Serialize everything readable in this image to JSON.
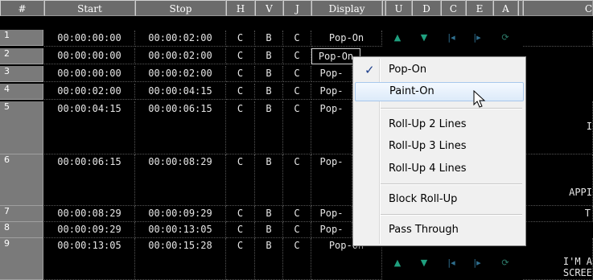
{
  "columns": [
    "#",
    "Start",
    "Stop",
    "H",
    "V",
    "J",
    "Display",
    "U",
    "D",
    "C",
    "E",
    "A",
    "C"
  ],
  "rows": [
    {
      "num": "1",
      "start": "00:00:00:00",
      "stop": "00:00:02:00",
      "h": "C",
      "v": "B",
      "j": "C",
      "display": "Pop-On",
      "caption": ""
    },
    {
      "num": "2",
      "start": "00:00:00:00",
      "stop": "00:00:02:00",
      "h": "C",
      "v": "B",
      "j": "C",
      "display": "Pop-On",
      "caption": ""
    },
    {
      "num": "3",
      "start": "00:00:00:00",
      "stop": "00:00:02:00",
      "h": "C",
      "v": "B",
      "j": "C",
      "display": "Pop-",
      "caption": ""
    },
    {
      "num": "4",
      "start": "00:00:02:00",
      "stop": "00:00:04:15",
      "h": "C",
      "v": "B",
      "j": "C",
      "display": "Pop-",
      "caption": ""
    },
    {
      "num": "5",
      "start": "00:00:04:15",
      "stop": "00:00:06:15",
      "h": "C",
      "v": "B",
      "j": "C",
      "display": "Pop-",
      "caption": "I"
    },
    {
      "num": "6",
      "start": "00:00:06:15",
      "stop": "00:00:08:29",
      "h": "C",
      "v": "B",
      "j": "C",
      "display": "Pop-",
      "caption": "APPI"
    },
    {
      "num": "7",
      "start": "00:00:08:29",
      "stop": "00:00:09:29",
      "h": "C",
      "v": "B",
      "j": "C",
      "display": "Pop-",
      "caption": "T"
    },
    {
      "num": "8",
      "start": "00:00:09:29",
      "stop": "00:00:13:05",
      "h": "C",
      "v": "B",
      "j": "C",
      "display": "Pop-",
      "caption": ""
    },
    {
      "num": "9",
      "start": "00:00:13:05",
      "stop": "00:00:15:28",
      "h": "C",
      "v": "B",
      "j": "C",
      "display": "Pop-On",
      "caption": "I'M A"
    },
    {
      "num": "",
      "caption": "SCREE"
    }
  ],
  "menu": {
    "items": [
      "Pop-On",
      "Paint-On",
      "Roll-Up 2 Lines",
      "Roll-Up 3 Lines",
      "Roll-Up 4 Lines",
      "Block Roll-Up",
      "Pass Through"
    ],
    "checked": "Pop-On",
    "highlighted": "Paint-On"
  },
  "icons": {
    "up": "arrow-up-icon",
    "down": "arrow-down-icon",
    "prev": "skip-back-icon",
    "next": "skip-forward-icon",
    "refresh": "refresh-icon"
  },
  "colors": {
    "background": "#000000",
    "header": "#6b6b6b",
    "row_number": "#7a7a7a",
    "icon_teal": "#1fa07f",
    "menu_bg": "#f0f0f0"
  }
}
